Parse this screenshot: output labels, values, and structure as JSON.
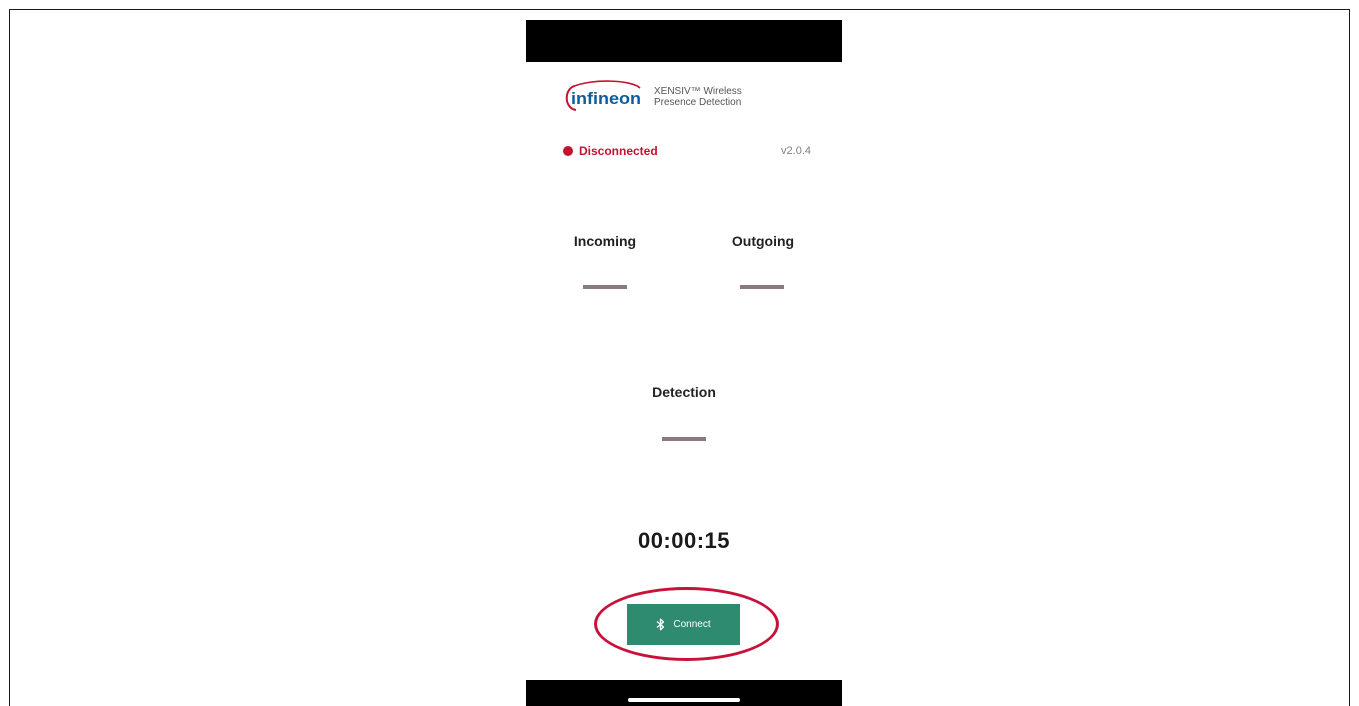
{
  "header": {
    "logo_text": "infineon",
    "title_line1": "XENSIV™ Wireless",
    "title_line2": "Presence Detection"
  },
  "connection": {
    "status": "Disconnected",
    "status_color": "#c4122f",
    "version": "v2.0.4"
  },
  "metrics": {
    "incoming_label": "Incoming",
    "outgoing_label": "Outgoing",
    "detection_label": "Detection"
  },
  "timer": "00:00:15",
  "connect_button": {
    "label": "Connect",
    "icon": "bluetooth-icon",
    "color": "#2e8b6f"
  },
  "highlight_color": "#c8123a"
}
